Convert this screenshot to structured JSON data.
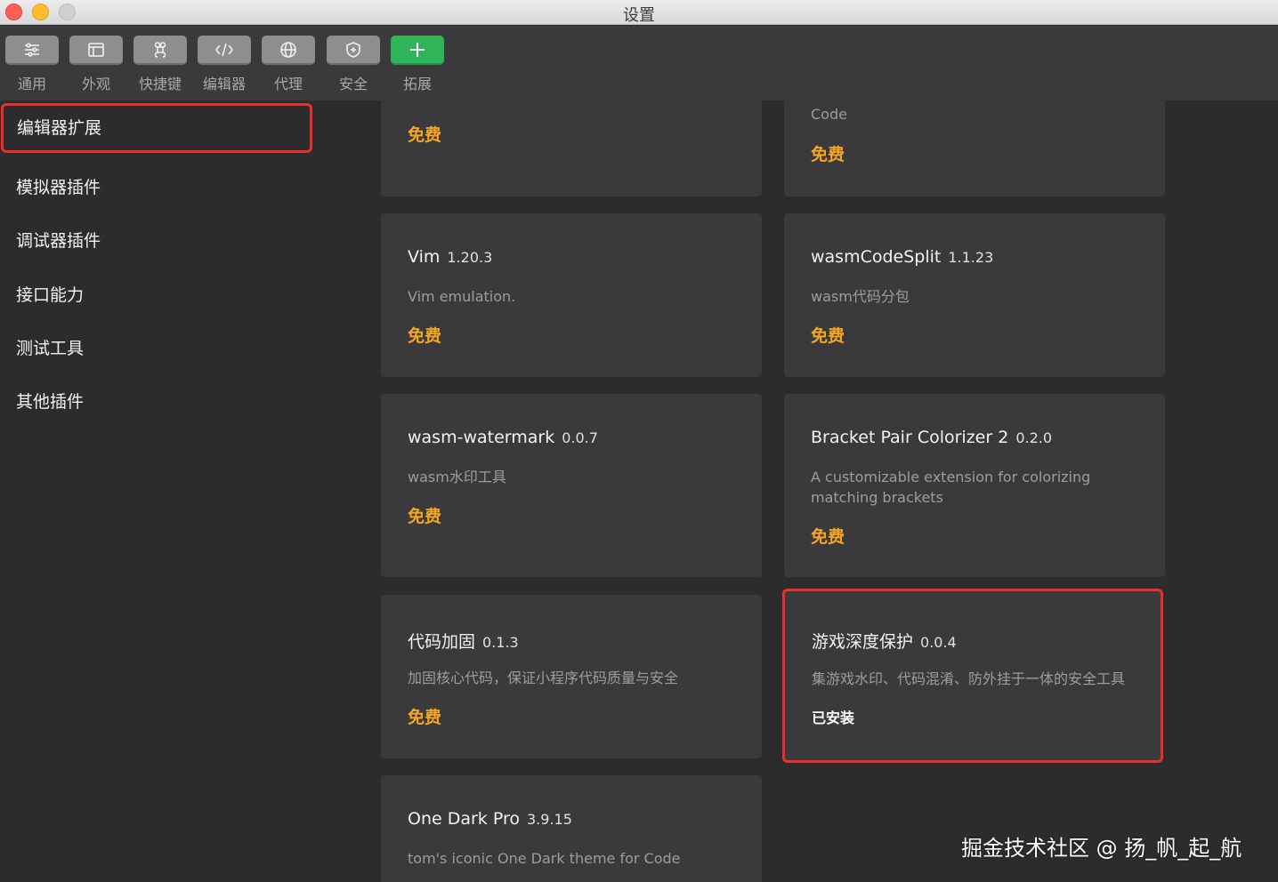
{
  "window": {
    "title": "设置"
  },
  "toolbar": {
    "items": [
      {
        "label": "通用",
        "icon": "sliders-icon"
      },
      {
        "label": "外观",
        "icon": "window-icon"
      },
      {
        "label": "快捷键",
        "icon": "command-key-icon"
      },
      {
        "label": "编辑器",
        "icon": "code-icon"
      },
      {
        "label": "代理",
        "icon": "globe-icon"
      },
      {
        "label": "安全",
        "icon": "shield-icon"
      },
      {
        "label": "拓展",
        "icon": "plus-icon"
      }
    ],
    "active_color": "#2fb45a"
  },
  "sidebar": {
    "items": [
      {
        "label": "编辑器扩展",
        "selected": true
      },
      {
        "label": "模拟器插件"
      },
      {
        "label": "调试器插件"
      },
      {
        "label": "接口能力"
      },
      {
        "label": "测试工具"
      },
      {
        "label": "其他插件"
      }
    ]
  },
  "extensions": [
    {
      "name": "",
      "version": "",
      "description": "",
      "price": "免费"
    },
    {
      "name": "",
      "version": "",
      "description": "Code",
      "price": "免费"
    },
    {
      "name": "Vim",
      "version": "1.20.3",
      "description": "Vim emulation.",
      "price": "免费"
    },
    {
      "name": "wasmCodeSplit",
      "version": "1.1.23",
      "description": "wasm代码分包",
      "price": "免费"
    },
    {
      "name": "wasm-watermark",
      "version": "0.0.7",
      "description": "wasm水印工具",
      "price": "免费"
    },
    {
      "name": "Bracket Pair Colorizer 2",
      "version": "0.2.0",
      "description": "A customizable extension for colorizing matching brackets",
      "price": "免费"
    },
    {
      "name": "代码加固",
      "version": "0.1.3",
      "description": "加固核心代码，保证小程序代码质量与安全",
      "price": "免费"
    },
    {
      "name": "游戏深度保护",
      "version": "0.0.4",
      "description": "集游戏水印、代码混淆、防外挂于一体的安全工具",
      "status": "已安装",
      "highlighted": true
    },
    {
      "name": "One Dark Pro",
      "version": "3.9.15",
      "description": "tom's iconic One Dark theme for Code"
    }
  ],
  "colors": {
    "price": "#f5a623",
    "highlight_border": "#e8302a"
  },
  "watermark": "掘金技术社区 @ 扬_帆_起_航"
}
